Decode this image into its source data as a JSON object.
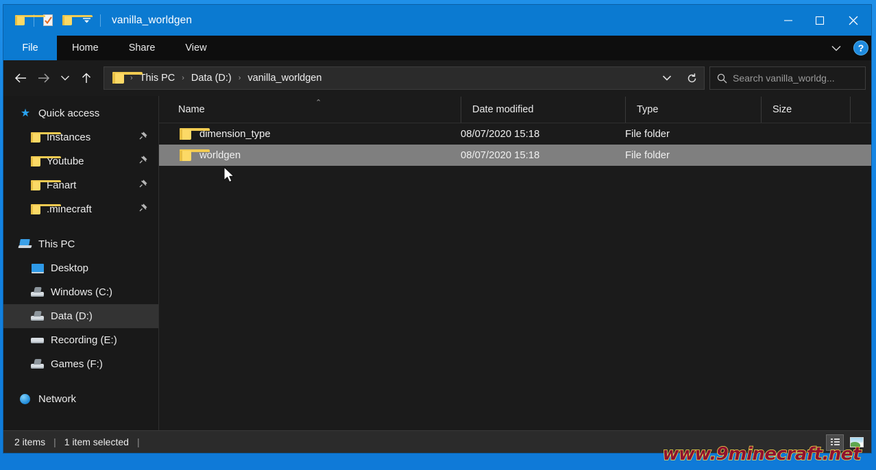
{
  "window": {
    "title": "vanilla_worldgen",
    "quick_access_toolbar": [
      {
        "name": "folder-icon",
        "label": "Folder"
      },
      {
        "name": "properties-icon",
        "label": "Properties"
      },
      {
        "name": "new-folder-icon",
        "label": "New folder"
      },
      {
        "name": "chevron-down-icon",
        "label": "Customize Quick Access Toolbar"
      }
    ],
    "controls": {
      "minimize": "—",
      "maximize": "☐",
      "close": "✕"
    }
  },
  "ribbon": {
    "tabs": [
      {
        "label": "File",
        "active": true
      },
      {
        "label": "Home",
        "active": false
      },
      {
        "label": "Share",
        "active": false
      },
      {
        "label": "View",
        "active": false
      }
    ],
    "expand_label": "∨",
    "help_label": "?"
  },
  "addressbar": {
    "back_label": "←",
    "forward_label": "→",
    "recent_label": "∨",
    "up_label": "↑",
    "crumbs": [
      "This PC",
      "Data (D:)",
      "vanilla_worldgen"
    ],
    "separator": "›",
    "dropdown_label": "∨",
    "refresh_label": "↻"
  },
  "search": {
    "placeholder": "Search vanilla_worldg...",
    "icon": "search-icon"
  },
  "sidebar": {
    "groups": [
      {
        "header": {
          "label": "Quick access",
          "icon": "star-icon"
        },
        "items": [
          {
            "label": "Instances",
            "icon": "folder-icon",
            "pinned": true,
            "pin": "📌"
          },
          {
            "label": "Youtube",
            "icon": "folder-icon",
            "pinned": true,
            "pin": "📌"
          },
          {
            "label": "Fanart",
            "icon": "folder-icon",
            "pinned": true,
            "pin": "📌"
          },
          {
            "label": ".minecraft",
            "icon": "folder-icon",
            "pinned": true,
            "pin": "📌"
          }
        ]
      },
      {
        "header": {
          "label": "This PC",
          "icon": "computer-icon"
        },
        "items": [
          {
            "label": "Desktop",
            "icon": "desktop-icon",
            "selected": false
          },
          {
            "label": "Windows (C:)",
            "icon": "drive-icon",
            "selected": false
          },
          {
            "label": "Data (D:)",
            "icon": "drive-icon",
            "selected": true
          },
          {
            "label": "Recording (E:)",
            "icon": "drive-icon",
            "selected": false
          },
          {
            "label": "Games (F:)",
            "icon": "drive-icon",
            "selected": false
          }
        ]
      },
      {
        "header": {
          "label": "Network",
          "icon": "network-icon"
        },
        "items": []
      }
    ]
  },
  "filelist": {
    "columns": [
      {
        "label": "Name",
        "sorted": "asc",
        "sort_mark": "⌃"
      },
      {
        "label": "Date modified",
        "sorted": null
      },
      {
        "label": "Type",
        "sorted": null
      },
      {
        "label": "Size",
        "sorted": null
      }
    ],
    "rows": [
      {
        "name": "dimension_type",
        "date": "08/07/2020 15:18",
        "type": "File folder",
        "size": "",
        "selected": false
      },
      {
        "name": "worldgen",
        "date": "08/07/2020 15:18",
        "type": "File folder",
        "size": "",
        "selected": true
      }
    ]
  },
  "statusbar": {
    "item_count": "2 items",
    "selection": "1 item selected",
    "separator": "|",
    "view_buttons": [
      {
        "name": "details-view-button",
        "active": true
      },
      {
        "name": "large-icons-view-button",
        "active": false
      }
    ]
  },
  "watermark": {
    "text": "www.9minecraft.net"
  },
  "colors": {
    "accent": "#0b7ad1",
    "window_bg": "#1b1b1b",
    "selection": "#7f7f7f",
    "nav_selection": "#333333",
    "folder_yellow": "#fcd966",
    "watermark_fill": "#8e1230",
    "watermark_stroke": "#f7e14c"
  }
}
